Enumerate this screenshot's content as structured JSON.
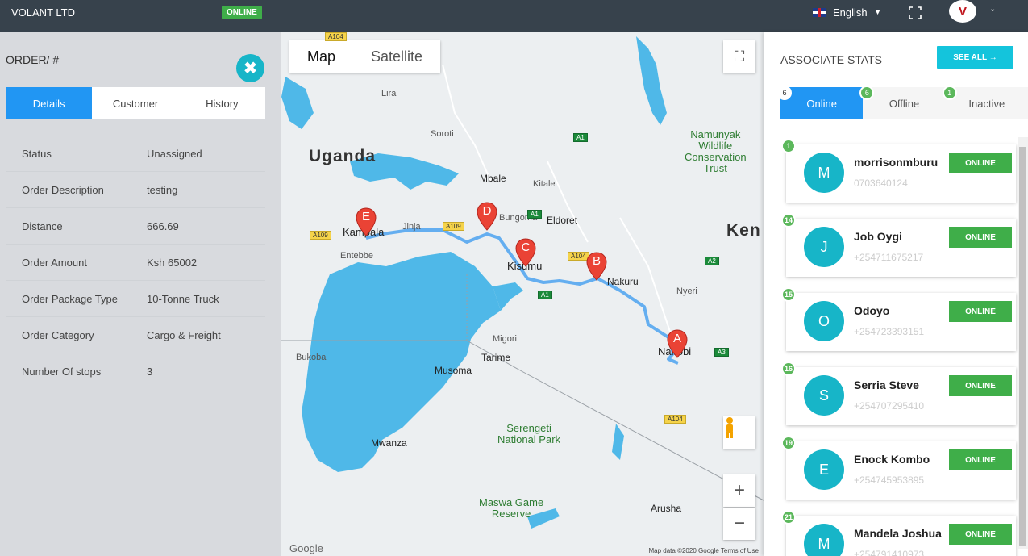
{
  "topbar": {
    "brand": "VOLANT LTD",
    "status": "ONLINE",
    "language": "English",
    "avatar_letter": "V"
  },
  "order": {
    "title": "ORDER/ #",
    "tabs": [
      "Details",
      "Customer",
      "History"
    ],
    "details": [
      {
        "label": "Status",
        "value": "Unassigned"
      },
      {
        "label": "Order Description",
        "value": "testing"
      },
      {
        "label": "Distance",
        "value": "666.69"
      },
      {
        "label": "Order Amount",
        "value": "Ksh 65002"
      },
      {
        "label": "Order Package Type",
        "value": "10-Tonne Truck"
      },
      {
        "label": "Order Category",
        "value": "Cargo & Freight"
      },
      {
        "label": "Number Of stops",
        "value": "3"
      }
    ]
  },
  "map": {
    "type_map": "Map",
    "type_satellite": "Satellite",
    "labels": {
      "uganda": "Uganda",
      "kenya": "Ken",
      "kampala": "Kampala",
      "kisumu": "Kisumu",
      "nairobi": "Nairobi",
      "nakuru": "Nakuru",
      "eldoret": "Eldoret",
      "mbale": "Mbale",
      "jinja": "Jinja",
      "entebbe": "Entebbe",
      "mwanza": "Mwanza",
      "musoma": "Musoma",
      "tarime": "Tarime",
      "migori": "Migori",
      "bukoba": "Bukoba",
      "arusha": "Arusha",
      "lira": "Lira",
      "soroti": "Soroti",
      "kitale": "Kitale",
      "bungoma": "Bungoma",
      "nyeri": "Nyeri",
      "serengeti": "Serengeti\nNational Park",
      "maswa": "Maswa Game\nReserve",
      "namunyak": "Namunyak\nWildlife\nConservation\nTrust"
    },
    "stops": [
      "A",
      "B",
      "C",
      "D",
      "E"
    ],
    "attribution": "Map data ©2020 Google   Terms of Use",
    "google": "Google"
  },
  "associates": {
    "title": "ASSOCIATE STATS",
    "see_all": "SEE ALL →",
    "tabs": [
      {
        "label": "Online",
        "count": "6"
      },
      {
        "label": "Offline",
        "count": "6"
      },
      {
        "label": "Inactive",
        "count": "1"
      }
    ],
    "list": [
      {
        "badge": "1",
        "initial": "M",
        "name": "morrisonmburu",
        "phone": "0703640124",
        "status": "ONLINE"
      },
      {
        "badge": "14",
        "initial": "J",
        "name": "Job Oygi",
        "phone": "+254711675217",
        "status": "ONLINE"
      },
      {
        "badge": "15",
        "initial": "O",
        "name": "Odoyo",
        "phone": "+254723393151",
        "status": "ONLINE"
      },
      {
        "badge": "16",
        "initial": "S",
        "name": "Serria Steve",
        "phone": "+254707295410",
        "status": "ONLINE"
      },
      {
        "badge": "19",
        "initial": "E",
        "name": "Enock Kombo",
        "phone": "+254745953895",
        "status": "ONLINE"
      },
      {
        "badge": "21",
        "initial": "M",
        "name": "Mandela Joshua",
        "phone": "+254791410973",
        "status": "ONLINE"
      }
    ]
  }
}
